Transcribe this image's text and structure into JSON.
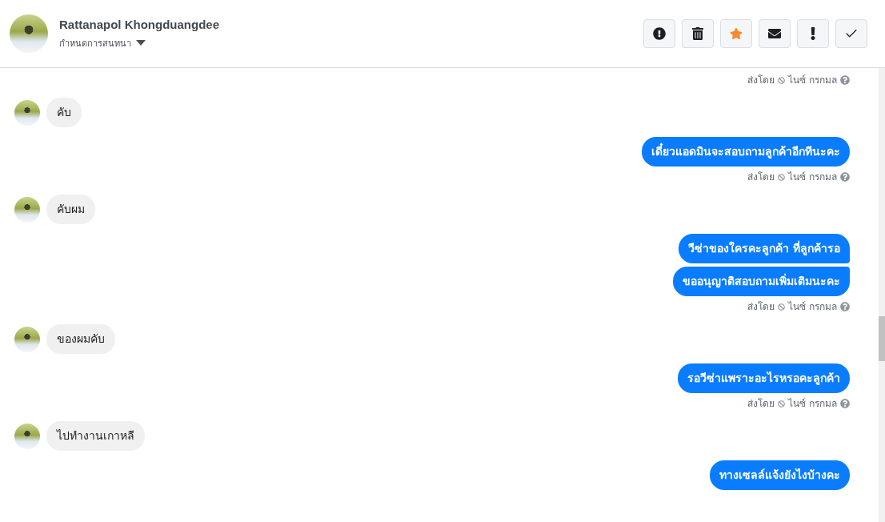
{
  "header": {
    "contact_name": "Rattanapol Khongduangdee",
    "conversation_menu": "กำหนดการสนทนา",
    "toolbar": [
      {
        "kind": "alert",
        "selected": false
      },
      {
        "kind": "delete",
        "selected": false
      },
      {
        "kind": "star",
        "selected": true
      },
      {
        "kind": "mail",
        "selected": false
      },
      {
        "kind": "important",
        "selected": false
      },
      {
        "kind": "done",
        "selected": false
      }
    ]
  },
  "messages": [
    {
      "kind": "status",
      "label": "ส่งโดย",
      "sender": "ไนซ์ กรกมล"
    },
    {
      "kind": "received",
      "text": "คับ"
    },
    {
      "kind": "sent",
      "bubbles": [
        "เดี๋ยวแอดมินจะสอบถามลูกค้าอีกทีนะคะ"
      ]
    },
    {
      "kind": "status",
      "label": "ส่งโดย",
      "sender": "ไนซ์ กรกมล"
    },
    {
      "kind": "received",
      "text": "คับผม"
    },
    {
      "kind": "sent",
      "bubbles": [
        "วีซ่าของใครคะลูกค้า ที่ลูกค้ารอ",
        "ขออนุญาติสอบถามเพิ่มเติมนะคะ"
      ]
    },
    {
      "kind": "status",
      "label": "ส่งโดย",
      "sender": "ไนซ์ กรกมล"
    },
    {
      "kind": "received",
      "text": "ของผมคับ"
    },
    {
      "kind": "sent",
      "bubbles": [
        "รอวีซ่าแพราะอะไรหรอคะลูกค้า"
      ]
    },
    {
      "kind": "status",
      "label": "ส่งโดย",
      "sender": "ไนซ์ กรกมล"
    },
    {
      "kind": "received",
      "text": "ไปทำงานเกาหลี"
    },
    {
      "kind": "sent",
      "bubbles": [
        "ทางเซลล์แจ้งยังไงบ้างคะ"
      ]
    }
  ]
}
